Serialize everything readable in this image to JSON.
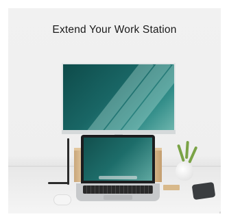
{
  "headline": "Extend Your Work Station",
  "scene": {
    "background_color": "#f0f0f0",
    "monitor_screen_color": "#196665",
    "laptop_screen_color": "#1d6d6a",
    "riser_color": "#d9bb8f"
  },
  "items": [
    {
      "name": "external-monitor",
      "icon": "monitor"
    },
    {
      "name": "laptop",
      "icon": "laptop"
    },
    {
      "name": "wooden-laptop-riser",
      "icon": "stand"
    },
    {
      "name": "wireless-mouse",
      "icon": "mouse"
    },
    {
      "name": "vase-with-plant",
      "icon": "plant"
    },
    {
      "name": "external-drive",
      "icon": "hard-drive"
    },
    {
      "name": "usb-adapter",
      "icon": "usb"
    }
  ]
}
